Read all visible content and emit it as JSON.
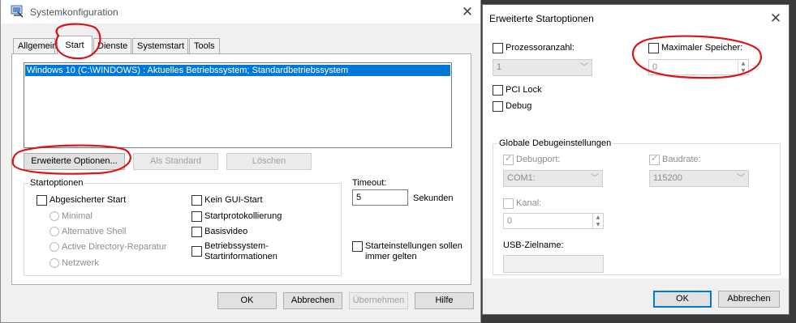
{
  "left_window": {
    "title": "Systemkonfiguration",
    "tabs": [
      {
        "label": "Allgemein"
      },
      {
        "label": "Start"
      },
      {
        "label": "Dienste"
      },
      {
        "label": "Systemstart"
      },
      {
        "label": "Tools"
      }
    ],
    "boot_entries": [
      "Windows 10 (C:\\WINDOWS) : Aktuelles Betriebssystem; Standardbetriebssystem"
    ],
    "buttons": {
      "advanced": "Erweiterte Optionen...",
      "set_default": "Als Standard",
      "delete": "Löschen"
    },
    "boot_options": {
      "group_label": "Startoptionen",
      "safe_boot": "Abgesicherter Start",
      "minimal": "Minimal",
      "alternate_shell": "Alternative Shell",
      "ad_repair": "Active Directory-Reparatur",
      "network": "Netzwerk",
      "no_gui": "Kein GUI-Start",
      "boot_log": "Startprotokollierung",
      "base_video": "Basisvideo",
      "os_boot_info": "Betriebssystem-Startinformationen"
    },
    "timeout": {
      "label": "Timeout:",
      "value": "5",
      "unit": "Sekunden"
    },
    "make_permanent": "Starteinstellungen sollen immer gelten",
    "footer": {
      "ok": "OK",
      "cancel": "Abbrechen",
      "apply": "Übernehmen",
      "help": "Hilfe"
    }
  },
  "right_window": {
    "title": "Erweiterte Startoptionen",
    "num_processors": {
      "label": "Prozessoranzahl:",
      "value": "1",
      "checked": false
    },
    "max_memory": {
      "label": "Maximaler Speicher:",
      "value": "0",
      "checked": false
    },
    "pci_lock": "PCI Lock",
    "debug": "Debug",
    "debug_settings": {
      "group_label": "Globale Debugeinstellungen",
      "debug_port": {
        "label": "Debugport:",
        "value": "COM1:",
        "checked": true
      },
      "baud_rate": {
        "label": "Baudrate:",
        "value": "115200",
        "checked": true
      },
      "channel": {
        "label": "Kanal:",
        "value": "0",
        "checked": false
      },
      "usb_target_label": "USB-Zielname:",
      "usb_target_value": ""
    },
    "footer": {
      "ok": "OK",
      "cancel": "Abbrechen"
    }
  },
  "colors": {
    "selection": "#0078d7",
    "annotation": "#d9141b"
  }
}
